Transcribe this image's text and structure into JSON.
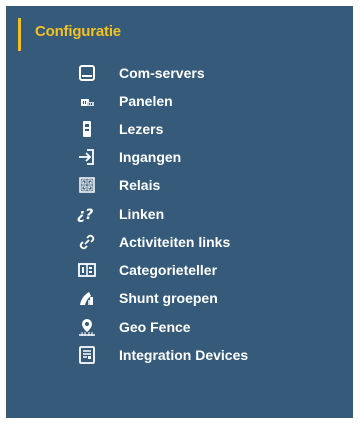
{
  "menu": {
    "section_title": "Configuratie",
    "colors": {
      "background": "#365b7a",
      "accent": "#f2bf1d",
      "text": "#ffffff"
    },
    "items": [
      {
        "label": "Com-servers",
        "icon": "server-box-icon"
      },
      {
        "label": "Panelen",
        "icon": "panel-board-icon"
      },
      {
        "label": "Lezers",
        "icon": "reader-device-icon"
      },
      {
        "label": "Ingangen",
        "icon": "input-arrow-icon"
      },
      {
        "label": "Relais",
        "icon": "relay-grid-icon"
      },
      {
        "label": "Linken",
        "icon": "question-link-icon"
      },
      {
        "label": "Activiteiten links",
        "icon": "chain-link-icon"
      },
      {
        "label": "Categorieteller",
        "icon": "category-counter-icon"
      },
      {
        "label": "Shunt groepen",
        "icon": "shunt-group-icon"
      },
      {
        "label": "Geo Fence",
        "icon": "geo-fence-icon"
      },
      {
        "label": "Integration Devices",
        "icon": "integration-device-icon"
      }
    ]
  }
}
